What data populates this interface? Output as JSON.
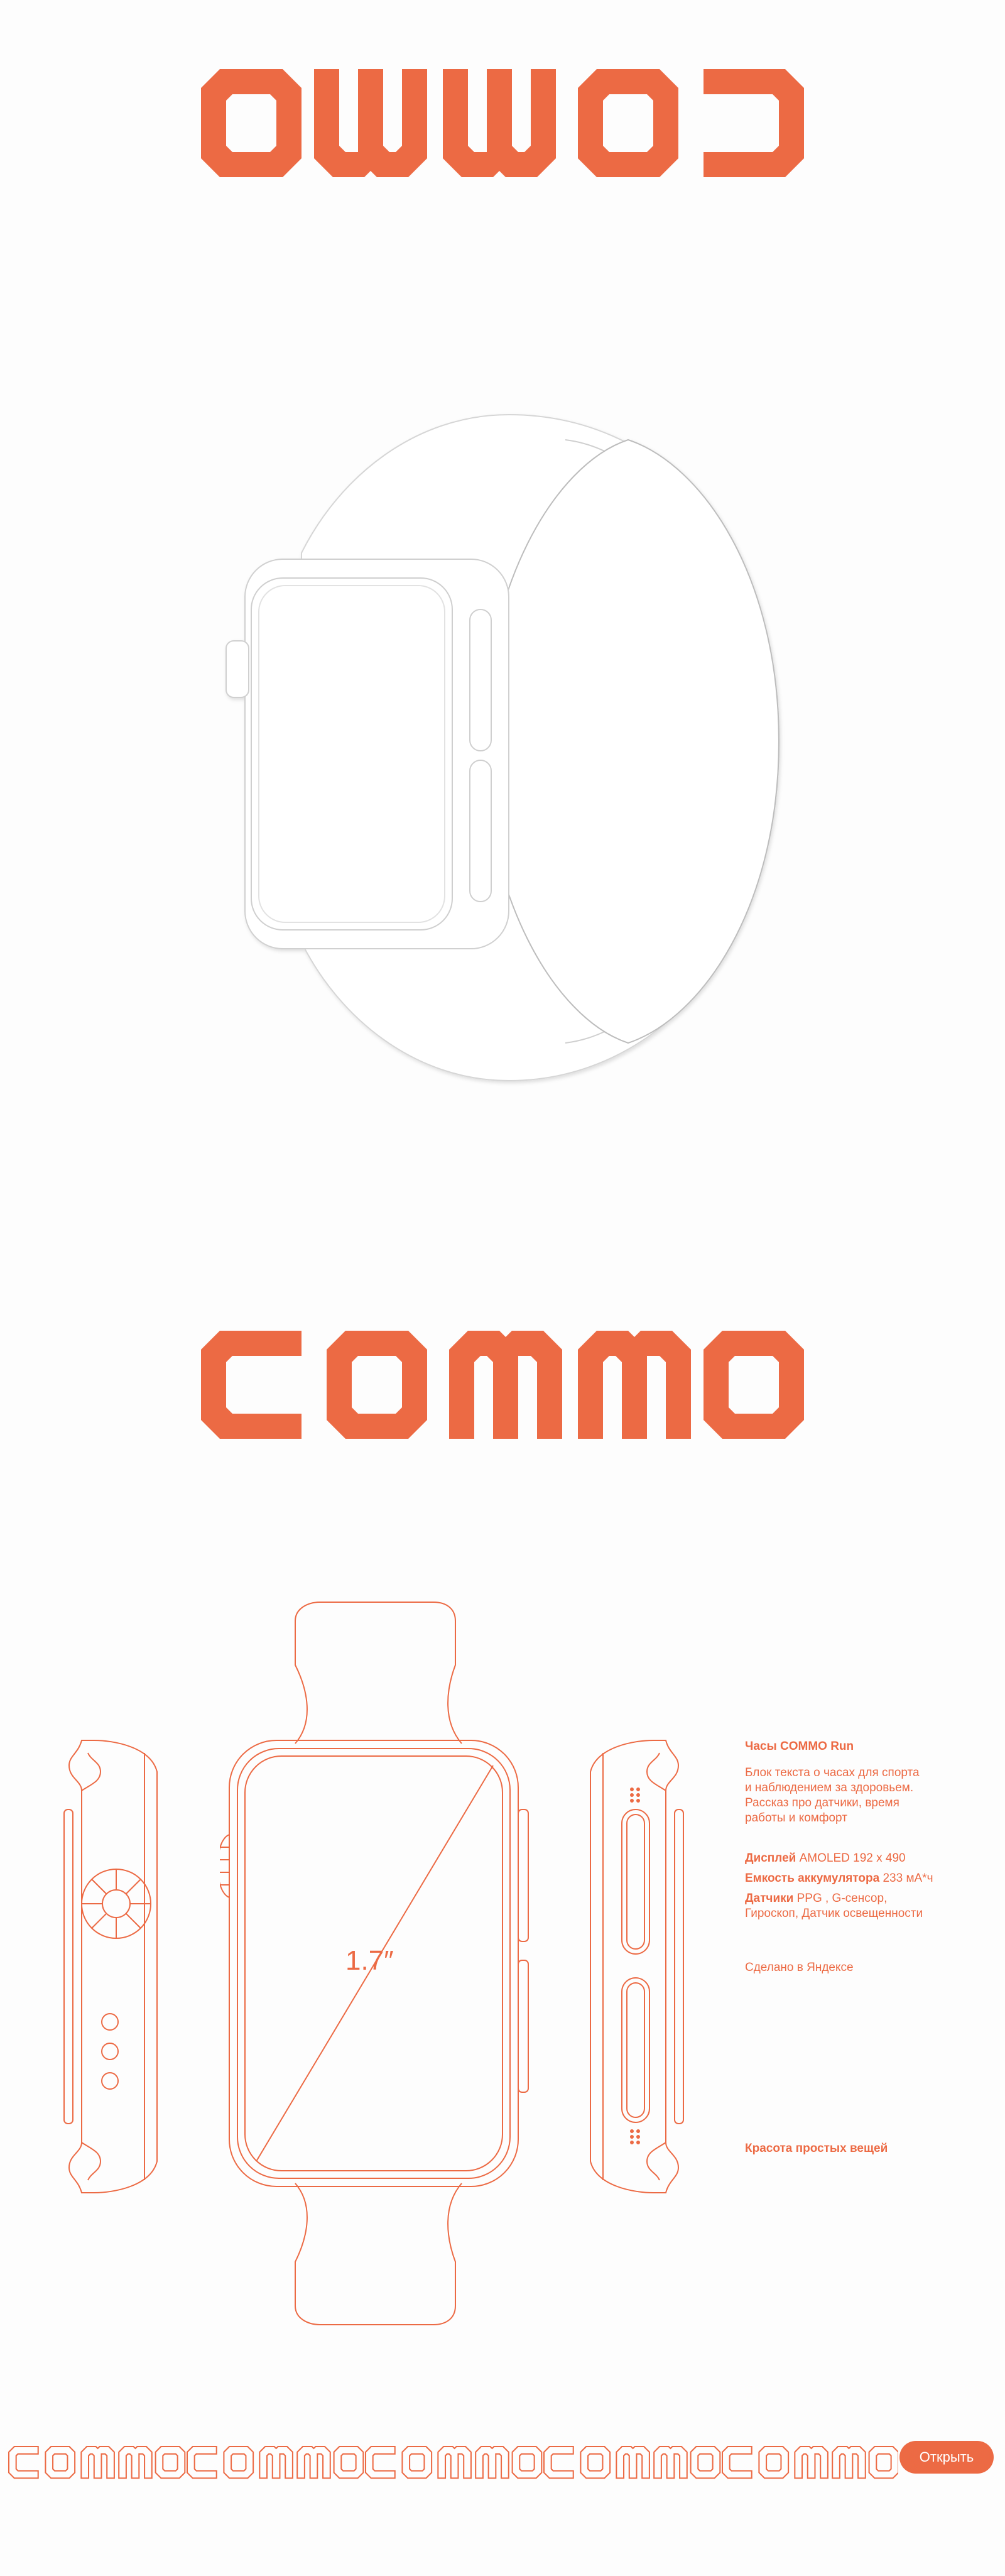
{
  "brand": {
    "logo_text": "COMMO",
    "accent_color": "#ec6a44"
  },
  "hero": {
    "image_name": "watch-3d-outline"
  },
  "blueprint": {
    "diagonal_label": "1.7″"
  },
  "spec": {
    "title": "Часы COMMO Run",
    "description_lines": [
      "Блок текста о часах для спорта",
      "и наблюдением за здоровьем.",
      "Рассказ про датчики, время",
      "работы и комфорт"
    ],
    "display_label": "Дисплей",
    "display_value": "AMOLED 192 x 490",
    "battery_label": "Емкость аккумулятора",
    "battery_value": "233 мА*ч",
    "sensors_label": "Датчики",
    "sensors_value_line1": "PPG , G-сенсор,",
    "sensors_value_line2": "Гироскоп, Датчик освещенности",
    "made_in": "Сделано в Яндексе",
    "slogan": "Красота простых вещей"
  },
  "footer": {
    "marquee_text": "COMMO",
    "open_button_label": "Открыть"
  }
}
